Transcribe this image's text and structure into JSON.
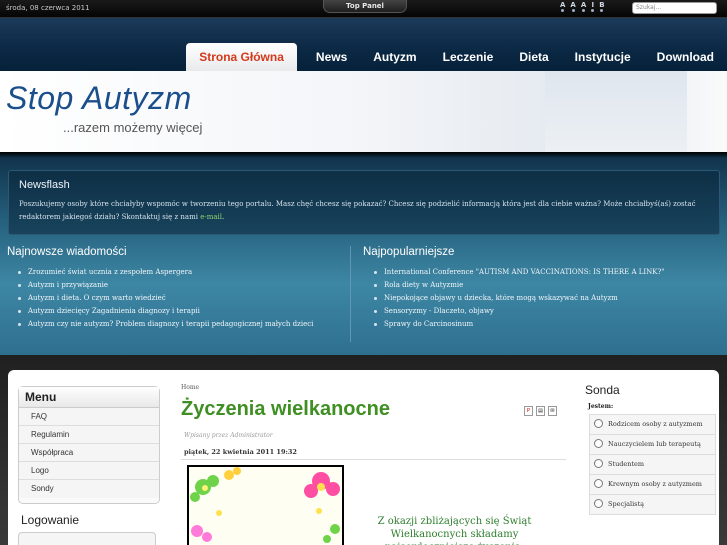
{
  "topbar": {
    "date": "środa, 08 czerwca 2011",
    "top_panel": "Top Panel",
    "font_sizer": [
      "A",
      "A",
      "A",
      "I",
      "B"
    ],
    "search_placeholder": "Szukaj..."
  },
  "nav": {
    "items": [
      {
        "label": "Strona Główna",
        "active": true
      },
      {
        "label": "News"
      },
      {
        "label": "Autyzm"
      },
      {
        "label": "Leczenie"
      },
      {
        "label": "Dieta"
      },
      {
        "label": "Instytucje"
      },
      {
        "label": "Download"
      }
    ]
  },
  "header": {
    "title": "Stop Autyzm",
    "subtitle": "...razem możemy więcej"
  },
  "newsflash": {
    "title": "Newsflash",
    "text": "Poszukujemy osoby które chciałyby wspomóc w tworzeniu tego portalu. Masz chęć chcesz się pokazać? Chcesz się podzielić informacją która jest dla ciebie ważna? Może chciałbyś(aś) zostać redaktorem jakiegoś działu? Skontaktuj się z nami",
    "mail_label": "e-mail",
    "end": "."
  },
  "latest": {
    "title": "Najnowsze wiadomości",
    "items": [
      "Zrozumieć świat ucznia z zespołem Aspergera",
      "Autyzm i przywiązanie",
      "Autyzm i dieta. O czym warto wiedzieć",
      "Autyzm dziecięcy Zagadnienia diagnozy i terapii",
      "Autyzm czy nie autyzm? Problem diagnozy i terapii pedagogicznej małych dzieci"
    ]
  },
  "popular": {
    "title": "Najpopularniejsze",
    "items": [
      "International Conference \"AUTISM AND VACCINATIONS: IS THERE A LINK?\"",
      "Rola diety w Autyzmie",
      "Niepokojące objawy u dziecka, które mogą wskazywać na Autyzm",
      "Sensoryzmy - Dlaczeto, objawy",
      "Sprawy do Carcinosinum"
    ]
  },
  "menu": {
    "title": "Menu",
    "items": [
      "FAQ",
      "Regulamin",
      "Współpraca",
      "Logo",
      "Sondy"
    ]
  },
  "login": {
    "title": "Logowanie"
  },
  "article": {
    "breadcrumb": "Home",
    "title": "Życzenia wielkanocne",
    "icons": [
      "pdf-icon",
      "print-icon",
      "email-icon"
    ],
    "author": "Wpisany przez Administrator",
    "date": "piątek, 22 kwietnia 2011 19:32",
    "greeting": "Z okazji zbliżających się Świąt Wielkanocnych składamy najserdeczniejsze życzenia:"
  },
  "poll": {
    "title": "Sonda",
    "question": "Jestem:",
    "options": [
      "Rodzicem osoby z autyzmem",
      "Nauczycielem lub terapeutą",
      "Studentem",
      "Krewnym osoby z autyzmem",
      "Specjalistą"
    ]
  },
  "colors": {
    "nav_active": "#d43a1a",
    "title_green": "#3f8f23",
    "brand_blue": "#1b4f8c"
  }
}
